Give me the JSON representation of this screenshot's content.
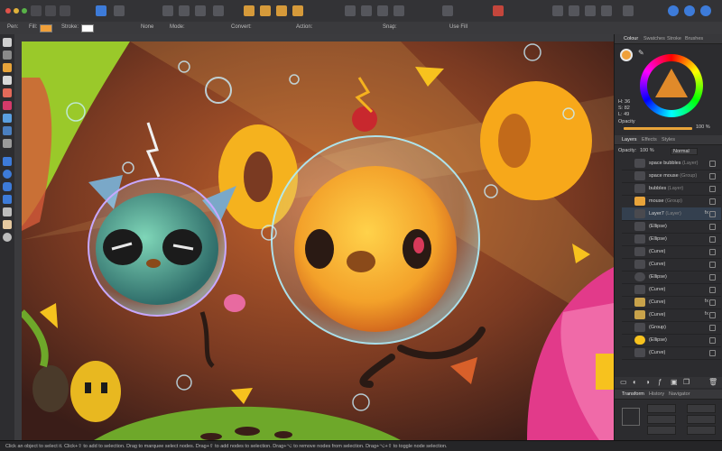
{
  "context_toolbar": {
    "pen_label": "Pen:",
    "fill_label": "Fill:",
    "stroke_label": "Stroke:",
    "stroke_value": "None",
    "mode_label": "Mode:",
    "convert_label": "Convert:",
    "action_label": "Action:",
    "snap_label": "Snap:",
    "use_fill_label": "Use Fill",
    "fill_color": "#f0a03a"
  },
  "panel": {
    "top_tabs": [
      "Colour",
      "Swatches",
      "Stroke",
      "Brushes"
    ],
    "hsl": {
      "h": "H: 36",
      "s": "S: 82",
      "l": "L: 49"
    },
    "opacity_label": "Opacity",
    "opacity_value": "100 %",
    "layer_tabs": [
      "Layers",
      "Effects",
      "Styles"
    ],
    "layer_opacity_label": "Opacity:",
    "layer_opacity_value": "100 %",
    "blend_mode": "Normal",
    "layers": [
      {
        "name": "space bubbles",
        "kind": "(Layer)"
      },
      {
        "name": "space mouse",
        "kind": "(Group)"
      },
      {
        "name": "bubbles",
        "kind": "(Layer)"
      },
      {
        "name": "mouse",
        "kind": "(Group)"
      },
      {
        "name": "Layer7",
        "kind": "(Layer)",
        "fx": "fx"
      },
      {
        "name": "(Ellipse)",
        "kind": ""
      },
      {
        "name": "(Ellipse)",
        "kind": ""
      },
      {
        "name": "(Curve)",
        "kind": ""
      },
      {
        "name": "(Curve)",
        "kind": ""
      },
      {
        "name": "(Ellipse)",
        "kind": ""
      },
      {
        "name": "(Curve)",
        "kind": ""
      },
      {
        "name": "(Curve)",
        "kind": "",
        "fx": "fx"
      },
      {
        "name": "(Curve)",
        "kind": "",
        "fx": "fx"
      },
      {
        "name": "(Group)",
        "kind": ""
      },
      {
        "name": "(Ellipse)",
        "kind": ""
      },
      {
        "name": "(Curve)",
        "kind": ""
      }
    ],
    "bottom_tabs": [
      "Transform",
      "History",
      "Navigator"
    ]
  },
  "status_text": "Click an object to select it. Click+⇧ to add to selection. Drag to marquee select nodes. Drag+⇧ to add nodes to selection. Drag+⌥ to remove nodes from selection. Drag+⌥+⇧ to toggle node selection.",
  "colors": {
    "accent": "#3d7bd9",
    "canvas_bg": "#7a3a22",
    "cheese": "#f7b21c"
  }
}
